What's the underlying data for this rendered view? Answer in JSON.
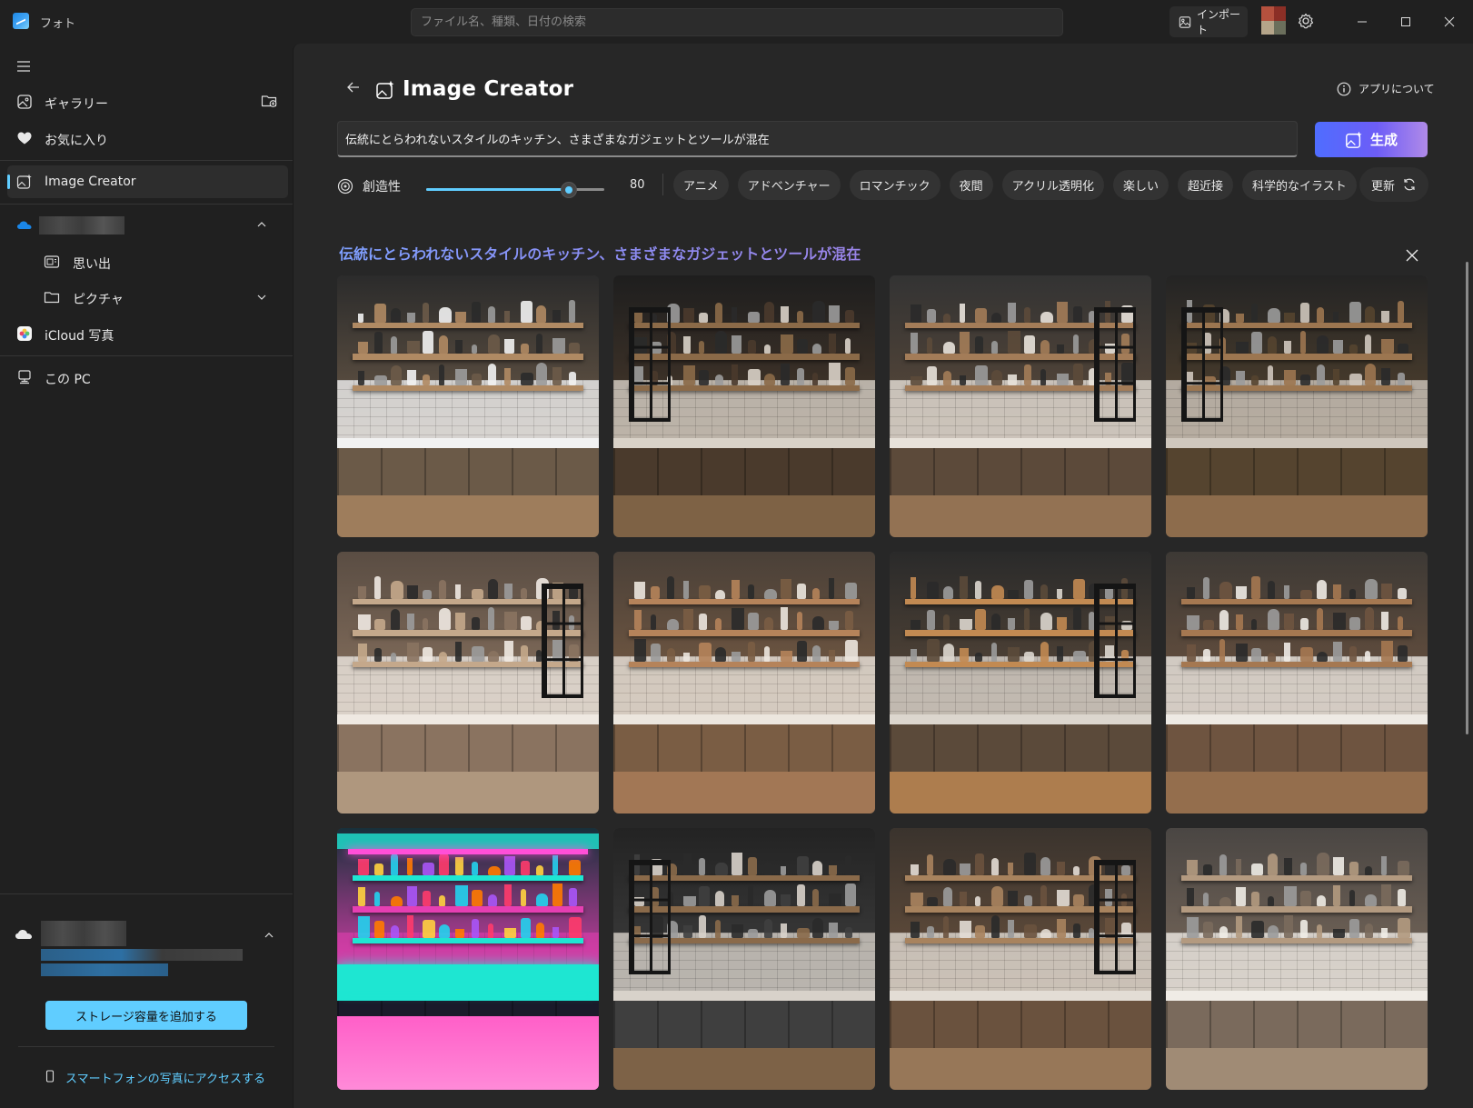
{
  "app": {
    "title": "フォト"
  },
  "search": {
    "placeholder": "ファイル名、種類、日付の検索"
  },
  "toolbar": {
    "import_label": "インポート"
  },
  "sidebar": {
    "items": [
      {
        "label": "ギャラリー",
        "icon": "gallery-icon"
      },
      {
        "label": "お気に入り",
        "icon": "heart-icon"
      },
      {
        "label": "Image Creator",
        "icon": "image-creator-icon",
        "active": true
      },
      {
        "label": "思い出",
        "icon": "memories-icon"
      },
      {
        "label": "ピクチャ",
        "icon": "folder-icon"
      },
      {
        "label": "iCloud 写真",
        "icon": "icloud-icon"
      },
      {
        "label": "この PC",
        "icon": "pc-icon"
      }
    ],
    "storage_button": "ストレージ容量を追加する",
    "phone_link": "スマートフォンの写真にアクセスする"
  },
  "main": {
    "title": "Image Creator",
    "about_label": "アプリについて",
    "prompt_value": "伝統にとらわれないスタイルのキッチン、さまざまなガジェットとツールが混在",
    "generate_label": "生成",
    "creativity_label": "創造性",
    "creativity_value": 80,
    "creativity_text": "80",
    "styles": [
      "アニメ",
      "アドベンチャー",
      "ロマンチック",
      "夜間",
      "アクリル透明化",
      "楽しい",
      "超近接",
      "科学的なイラスト"
    ],
    "refresh_label": "更新",
    "result_prompt": "伝統にとらわれないスタイルのキッチン、さまざまなガジェットとツールが混在"
  },
  "colors": {
    "accent": "#60cdff",
    "generate_start": "#4f6dff",
    "generate_end": "#b08ae8",
    "background": "#202020",
    "panel": "#272727"
  },
  "images": [
    {
      "name": "kitchen-image-1",
      "palette": [
        "#2b2b2b",
        "#6b5a48",
        "#b08a63",
        "#f2f2f2"
      ]
    },
    {
      "name": "kitchen-image-2",
      "palette": [
        "#1e1e1e",
        "#4a3a2c",
        "#8b6a48",
        "#d9d2c8"
      ]
    },
    {
      "name": "kitchen-image-3",
      "palette": [
        "#333",
        "#5c4a3a",
        "#a37c58",
        "#e8e2da"
      ]
    },
    {
      "name": "kitchen-image-4",
      "palette": [
        "#242424",
        "#55442f",
        "#9c7650",
        "#cfc7bd"
      ]
    },
    {
      "name": "kitchen-image-5",
      "palette": [
        "#5a4d43",
        "#8a7360",
        "#c4a88b",
        "#efe9e2"
      ]
    },
    {
      "name": "kitchen-image-6",
      "palette": [
        "#4a4038",
        "#7a5d44",
        "#b5835a",
        "#ece6de"
      ]
    },
    {
      "name": "kitchen-image-7",
      "palette": [
        "#2a2a2a",
        "#5b4a3a",
        "#c28a52",
        "#dcd6ce"
      ]
    },
    {
      "name": "kitchen-image-8",
      "palette": [
        "#3d3935",
        "#6e5440",
        "#a57851",
        "#eeeae4"
      ]
    },
    {
      "name": "kitchen-image-9",
      "palette": [
        "#17303a",
        "#e63fb2",
        "#1ee6d2",
        "#ff5a4a"
      ]
    },
    {
      "name": "kitchen-image-10",
      "palette": [
        "#232323",
        "#3f3f3f",
        "#8a6a4a",
        "#d8d2ca"
      ]
    },
    {
      "name": "kitchen-image-11",
      "palette": [
        "#3a332d",
        "#6a523e",
        "#a8835e",
        "#e3ddd5"
      ]
    },
    {
      "name": "kitchen-image-12",
      "palette": [
        "#4a4643",
        "#7a6a5c",
        "#b39a80",
        "#f0ece6"
      ]
    }
  ]
}
